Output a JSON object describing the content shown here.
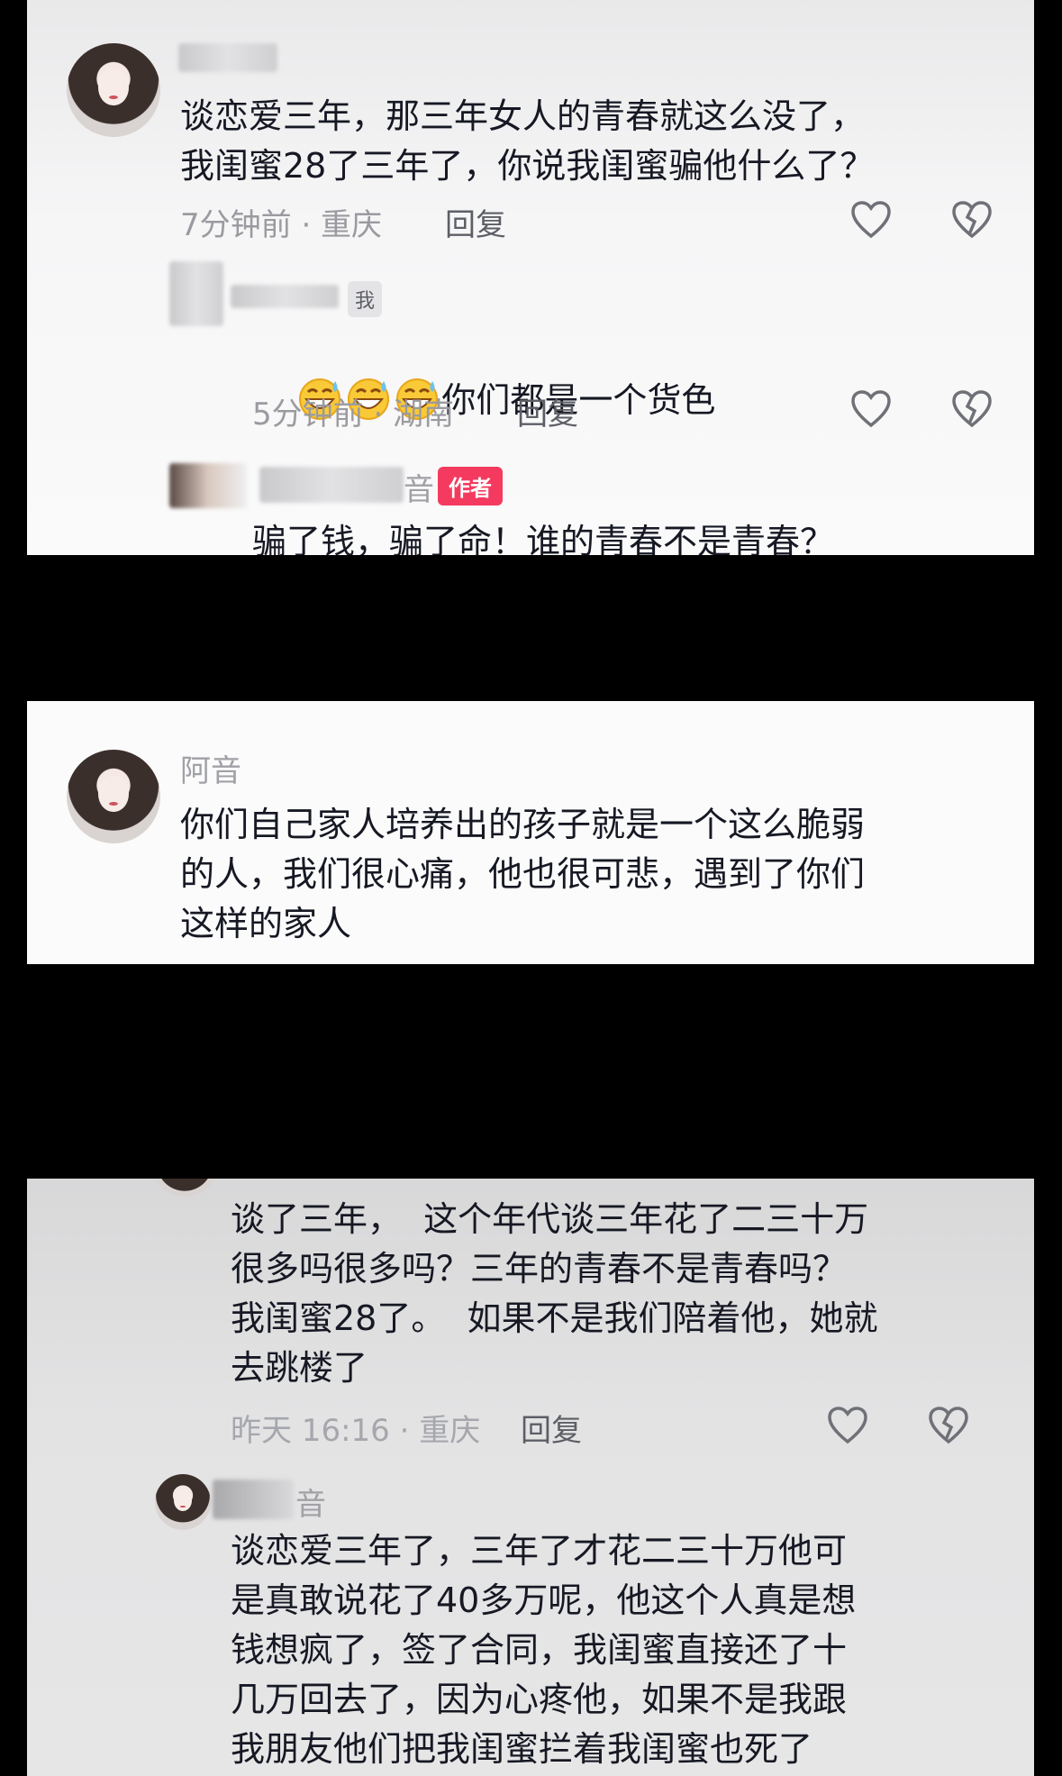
{
  "panel1": {
    "c1": {
      "text": "谈恋爱三年，那三年女人的青春就这么没了，\n我闺蜜28了三年了，你说我闺蜜骗他什么了？",
      "time": "7分钟前 · 重庆",
      "reply": "回复"
    },
    "c2": {
      "badge": "我",
      "text": "你们都是一个货色",
      "time": "5分钟前 · 湖南",
      "reply": "回复"
    },
    "c3": {
      "badge": "作者",
      "name_tail": "音",
      "text": "骗了钱，骗了命！谁的青春不是青春？"
    }
  },
  "panel2": {
    "name": "阿音",
    "text": "你们自己家人培养出的孩子就是一个这么脆弱\n的人，我们很心痛，他也很可悲，遇到了你们\n这样的家人"
  },
  "panel3": {
    "c1": {
      "text": "谈了三年，  这个年代谈三年花了二三十万\n很多吗很多吗？三年的青春不是青春吗？\n我闺蜜28了。  如果不是我们陪着他，她就\n去跳楼了",
      "time": "昨天 16:16 · 重庆",
      "reply": "回复"
    },
    "c2": {
      "name_tail": "音",
      "text": "谈恋爱三年了，三年了才花二三十万他可\n是真敢说花了40多万呢，他这个人真是想\n钱想疯了，签了合同，我闺蜜直接还了十\n几万回去了，因为心疼他，如果不是我跟\n我朋友他们把我闺蜜拦着我闺蜜也死了"
    }
  },
  "icons": [
    "heart-icon",
    "broken-heart-icon",
    "grin-sweat-emoji"
  ],
  "colors": {
    "author_badge": "#f43b5f",
    "text": "#161823",
    "meta": "#9a9aa0"
  }
}
